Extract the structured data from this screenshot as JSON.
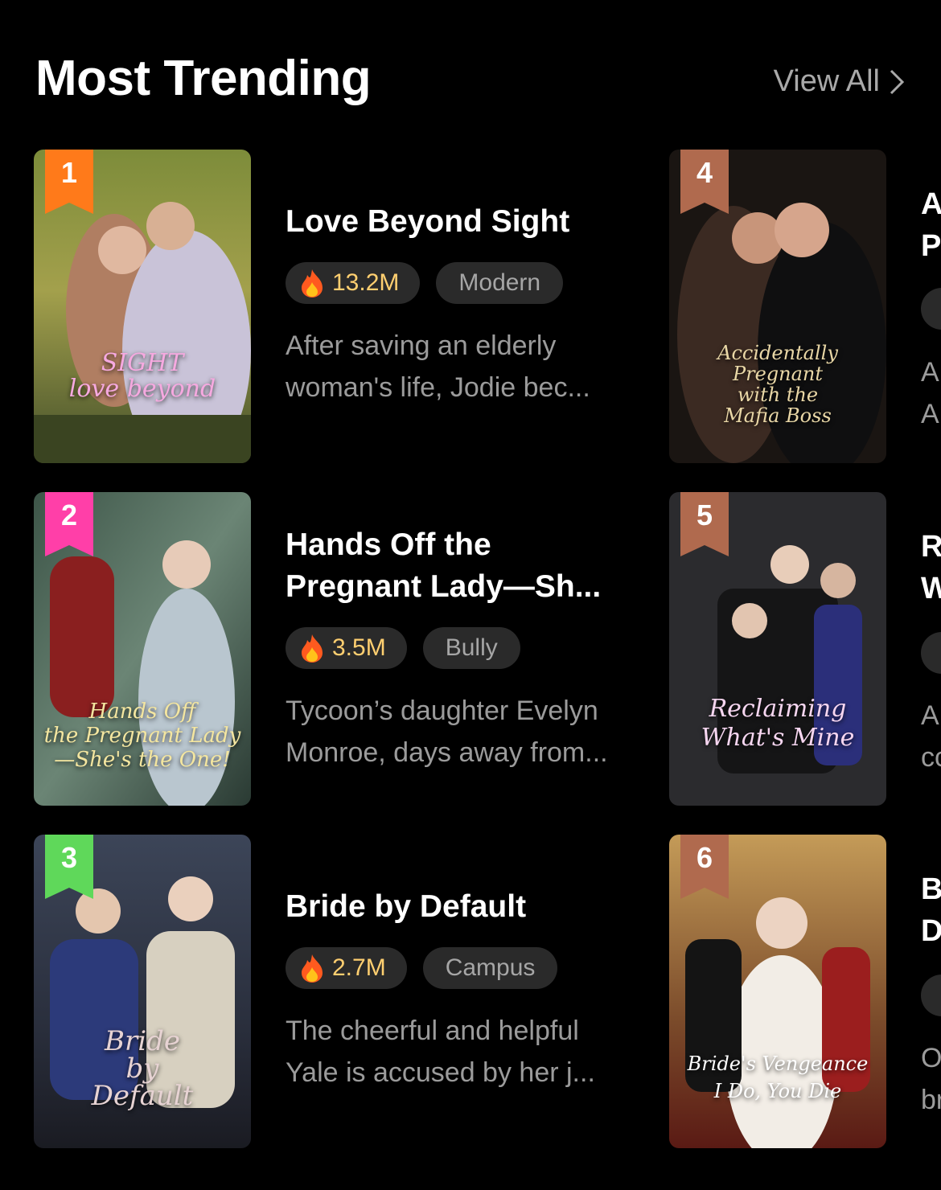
{
  "header": {
    "title": "Most Trending",
    "view_all": "View All"
  },
  "colors": {
    "rank1": "#ff7a1a",
    "rank2": "#ff3fa8",
    "rank3": "#5fd85a",
    "rank_other": "#b06a4e",
    "views_text": "#ffcf70"
  },
  "items": [
    {
      "rank": "1",
      "title": "Love Beyond Sight",
      "views": "13.2M",
      "genre": "Modern",
      "desc": "After saving an elderly\nwoman's life, Jodie bec...",
      "cover_text": "SIGHT\nlove beyond"
    },
    {
      "rank": "2",
      "title": "Hands Off the\nPregnant Lady—Sh...",
      "views": "3.5M",
      "genre": "Bully",
      "desc": "Tycoon’s daughter Evelyn\nMonroe, days away from...",
      "cover_text": "Hands Off\nthe Pregnant Lady\n—She's the One!"
    },
    {
      "rank": "3",
      "title": "Bride by Default",
      "views": "2.7M",
      "genre": "Campus",
      "desc": "The cheerful and helpful\nYale is accused by her j...",
      "cover_text": "Bride\nby\nDefault"
    },
    {
      "rank": "4",
      "cover_text": "Accidentally\nPregnant\nwith the\nMafia Boss",
      "peek_title": "A\nP",
      "peek_desc": "A\nA"
    },
    {
      "rank": "5",
      "cover_text": "Reclaiming\nWhat's Mine",
      "peek_title": "R\nW",
      "peek_desc": "A\ncc"
    },
    {
      "rank": "6",
      "cover_text": "Bride's Vengeance\nI Do, You Die",
      "peek_title": "B\nD",
      "peek_desc": "O\nbr"
    }
  ]
}
